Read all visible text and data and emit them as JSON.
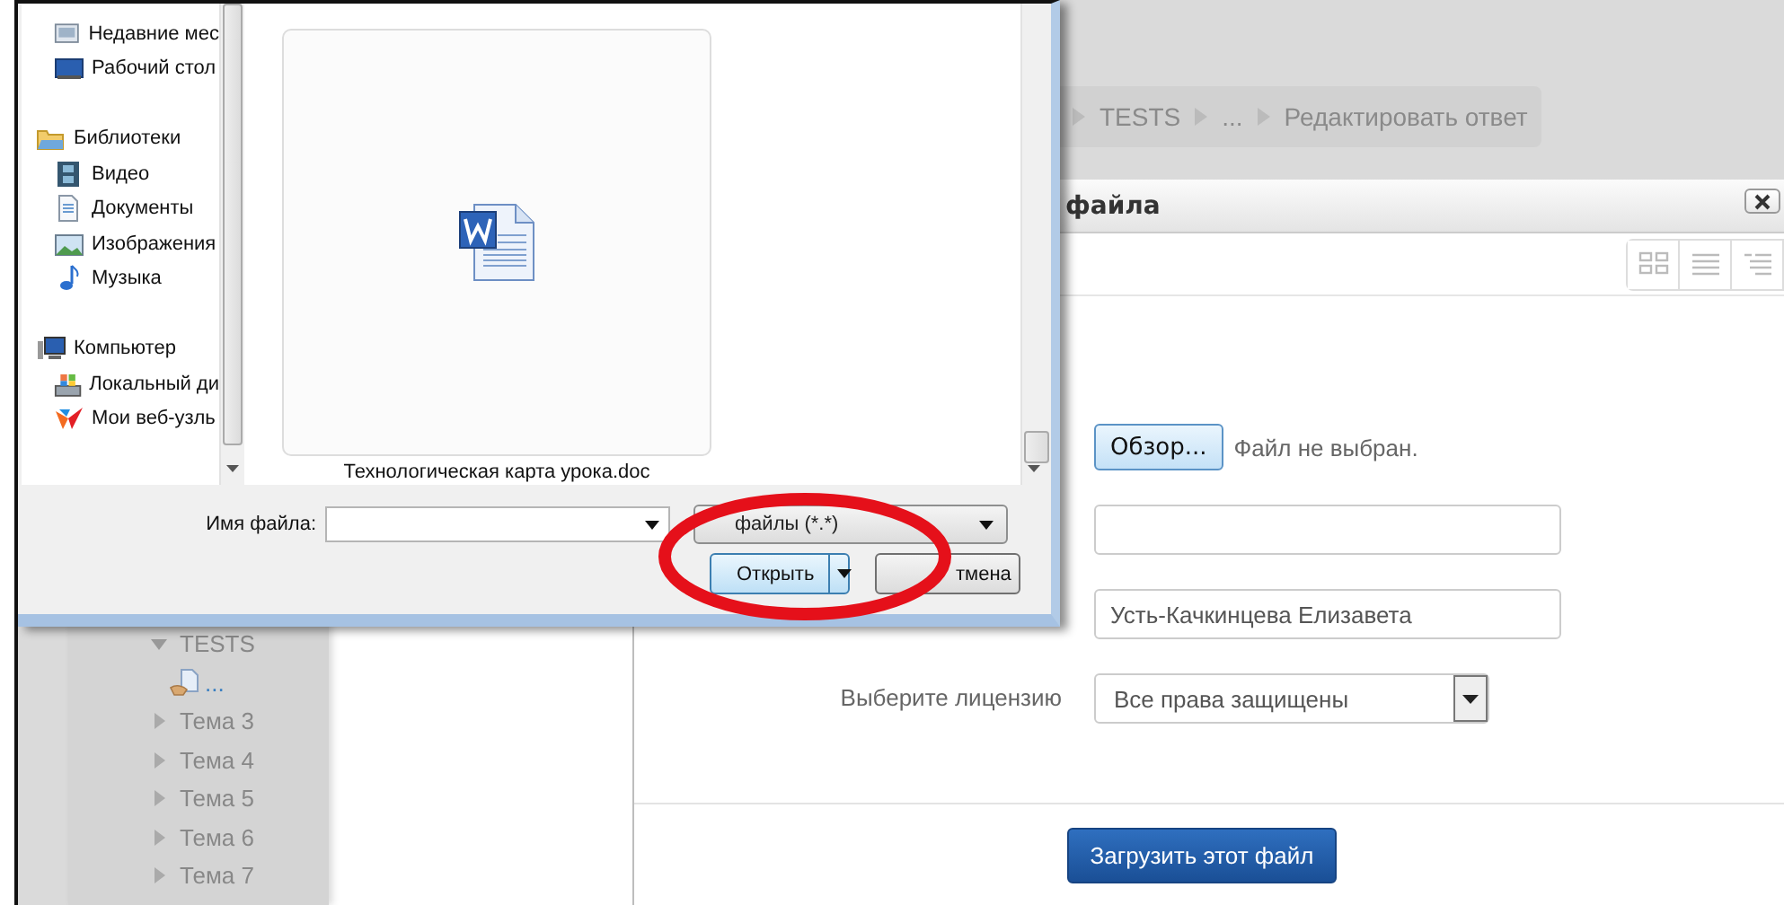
{
  "breadcrumb": [
    "TESTS",
    "...",
    "Редактировать ответ"
  ],
  "course_nav": [
    {
      "label": "TESTS",
      "expanded": true,
      "children": [
        {
          "label": "..."
        }
      ]
    },
    {
      "label": "Тема 3",
      "expanded": false
    },
    {
      "label": "Тема 4",
      "expanded": false
    },
    {
      "label": "Тема 5",
      "expanded": false
    },
    {
      "label": "Тема 6",
      "expanded": false
    },
    {
      "label": "Тема 7",
      "expanded": false
    }
  ],
  "upload_modal": {
    "title": "файла",
    "fields": [
      {
        "kind": "file",
        "button": "Обзор...",
        "status": "Файл не выбран."
      },
      {
        "kind": "text"
      },
      {
        "kind": "text",
        "value": "Усть-Качкинцева Елизавета"
      },
      {
        "kind": "select",
        "label": "Выберите лицензию",
        "value": "Все права защищены"
      }
    ],
    "submit": "Загрузить этот файл"
  },
  "file_dialog": {
    "nav": [
      {
        "children": [
          {
            "label": "Недавние мес",
            "kind": "recent"
          },
          {
            "label": "Рабочий стол",
            "kind": "desktop"
          }
        ]
      },
      {
        "label": "Библиотеки",
        "kind": "library",
        "children": [
          {
            "label": "Видео",
            "kind": "video"
          },
          {
            "label": "Документы",
            "kind": "documents"
          },
          {
            "label": "Изображения",
            "kind": "pictures"
          },
          {
            "label": "Музыка",
            "kind": "music"
          }
        ]
      },
      {
        "label": "Компьютер",
        "kind": "computer",
        "children": [
          {
            "label": "Локальный ди",
            "kind": "disk"
          },
          {
            "label": "Мои веб-узль",
            "kind": "web"
          }
        ]
      }
    ],
    "files": [
      {
        "name": "Технологическая карта урока.doc"
      }
    ],
    "filename_label": "Имя файла:",
    "filetype": "файлы (*.*)",
    "open_button": "Открыть",
    "cancel_button": "тмена"
  }
}
